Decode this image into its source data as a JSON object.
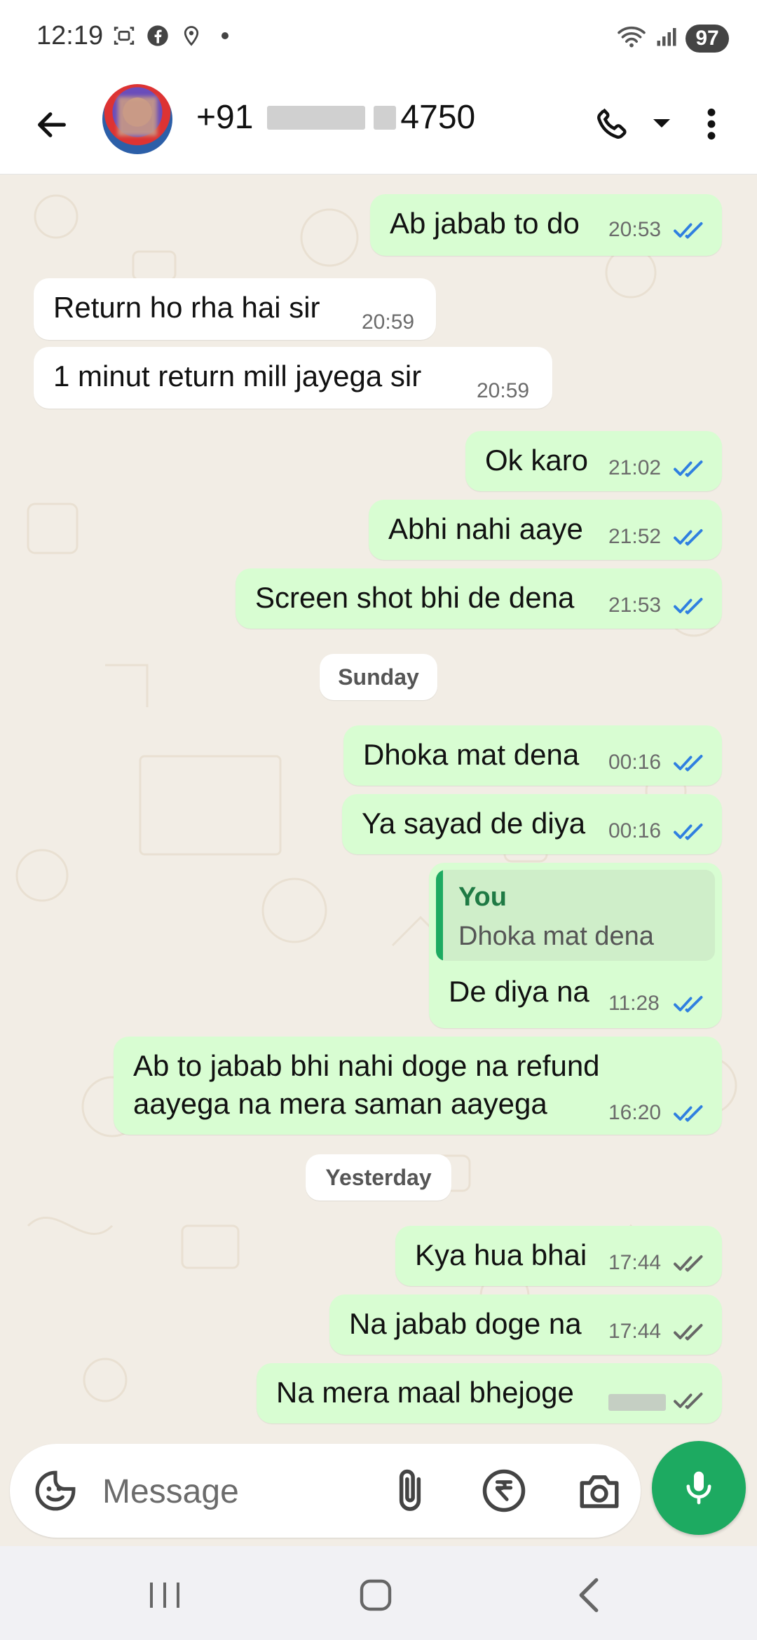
{
  "status_bar": {
    "time": "12:19",
    "battery": "97",
    "left_icons": [
      "screenshot-icon",
      "facebook-icon",
      "location-icon",
      "dot-icon"
    ],
    "right_icons": [
      "wifi-icon",
      "signal-icon"
    ]
  },
  "header": {
    "contact_prefix": "+91",
    "contact_suffix": "4750",
    "icons": [
      "back-arrow-icon",
      "phone-icon",
      "dropdown-icon",
      "more-vert-icon"
    ]
  },
  "colors": {
    "outgoing_bubble": "#d8fdd2",
    "incoming_bubble": "#ffffff",
    "accent_green": "#1daa61",
    "read_tick_blue": "#2f7fe0",
    "chat_background": "#f2ede5"
  },
  "chat": {
    "messages": [
      {
        "dir": "out",
        "text": "Ab jabab to do",
        "time": "20:53",
        "status": "read"
      },
      {
        "dir": "in",
        "text": "Return ho rha hai sir",
        "time": "20:59"
      },
      {
        "dir": "in",
        "text": "1 minut return mill jayega sir",
        "time": "20:59"
      },
      {
        "dir": "out",
        "text": "Ok karo",
        "time": "21:02",
        "status": "read"
      },
      {
        "dir": "out",
        "text": "Abhi nahi aaye",
        "time": "21:52",
        "status": "read"
      },
      {
        "dir": "out",
        "text": "Screen shot bhi de dena",
        "time": "21:53",
        "status": "read"
      },
      {
        "date": "Sunday"
      },
      {
        "dir": "out",
        "text": "Dhoka mat dena",
        "time": "00:16",
        "status": "read"
      },
      {
        "dir": "out",
        "text": "Ya sayad de diya",
        "time": "00:16",
        "status": "read"
      },
      {
        "dir": "out",
        "reply_author": "You",
        "reply_text": "Dhoka mat dena",
        "text": "De diya na",
        "time": "11:28",
        "status": "read"
      },
      {
        "dir": "out",
        "text_line1": "Ab to jabab bhi nahi doge na refund",
        "text_line2": "aayega na mera saman aayega",
        "time": "16:20",
        "status": "read"
      },
      {
        "date": "Yesterday"
      },
      {
        "dir": "out",
        "text": "Kya hua bhai",
        "time": "17:44",
        "status": "delivered"
      },
      {
        "dir": "out",
        "text": "Na jabab doge na",
        "time": "17:44",
        "status": "delivered"
      },
      {
        "dir": "out",
        "text": "Na mera maal bhejoge",
        "time": "",
        "status": "delivered"
      }
    ]
  },
  "composer": {
    "placeholder": "Message",
    "icons": [
      "sticker-icon",
      "attach-icon",
      "rupee-icon",
      "camera-icon",
      "mic-icon"
    ]
  },
  "nav_bar": {
    "icons": [
      "recent-apps-icon",
      "home-icon",
      "back-icon"
    ]
  }
}
